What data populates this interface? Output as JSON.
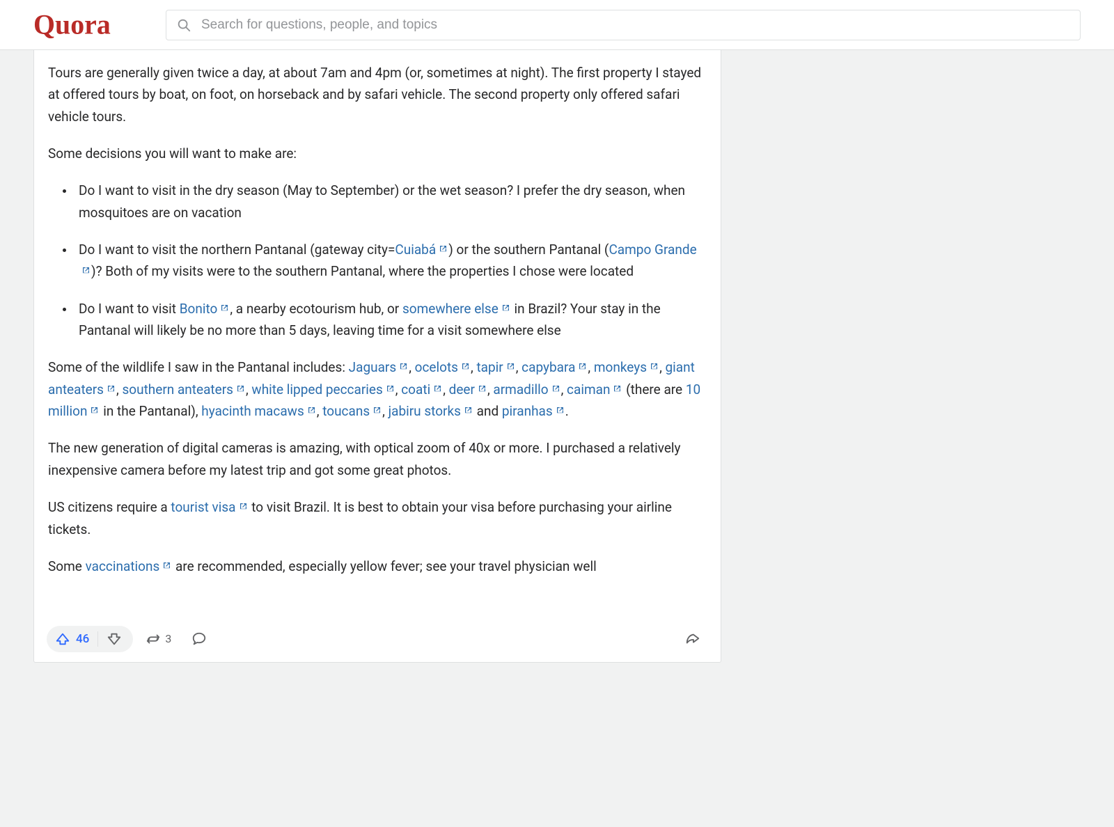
{
  "header": {
    "logo_text": "Quora",
    "search_placeholder": "Search for questions, people, and topics"
  },
  "answer": {
    "p1": "Tours are generally given twice a day, at about 7am and 4pm (or, sometimes at night). The first property I stayed at offered tours by boat, on foot, on horseback and by safari vehicle. The second property only offered safari vehicle tours.",
    "p2": "Some decisions you will want to make are:",
    "li1": "Do I want to visit in the dry season (May to September) or the wet season? I prefer the dry season, when mosquitoes are on vacation",
    "li2a": "Do I want to visit the northern Pantanal (gateway city=",
    "li2_link1": "Cuiabá",
    "li2b": ") or the southern Pantanal (",
    "li2_link2": "Campo Grande",
    "li2c": ")? Both of my visits were to the southern Pantanal, where the properties I chose were located",
    "li3a": "Do I want to visit ",
    "li3_link1": "Bonito",
    "li3b": ", a nearby ecotourism hub, or ",
    "li3_link2": "somewhere else",
    "li3c": " in Brazil? Your stay in the Pantanal will likely be no more than 5 days, leaving time for a visit somewhere else",
    "wildlife_intro": "Some of the wildlife I saw in the Pantanal includes: ",
    "wildlife_count_pre": " (there are ",
    "wildlife_count_link": "10 million",
    "wildlife_count_post": " in the Pantanal), ",
    "wildlife_and": " and ",
    "links": {
      "jaguars": "Jaguars",
      "ocelots": "ocelots",
      "tapir": "tapir",
      "capybara": "capybara",
      "monkeys": "monkeys",
      "giant_anteaters": "giant anteaters",
      "southern_anteaters": "southern anteaters",
      "wlp": "white lipped peccaries",
      "coati": "coati",
      "deer": "deer",
      "armadillo": "armadillo",
      "caiman": "caiman",
      "hyacinth": "hyacinth macaws",
      "toucans": "toucans",
      "jabiru": "jabiru storks",
      "piranhas": "piranhas"
    },
    "p4": "The new generation of digital cameras is amazing, with optical zoom of 40x or more. I purchased a relatively inexpensive camera before my latest trip and got some great photos.",
    "p5a": "US citizens require a ",
    "p5_link": "tourist visa",
    "p5b": " to visit Brazil. It is best to obtain your visa before purchasing your airline tickets.",
    "p6a": "Some ",
    "p6_link": "vaccinations",
    "p6b": " are recommended, especially yellow fever; see your travel physician well"
  },
  "actions": {
    "upvote_count": "46",
    "share_count": "3"
  }
}
